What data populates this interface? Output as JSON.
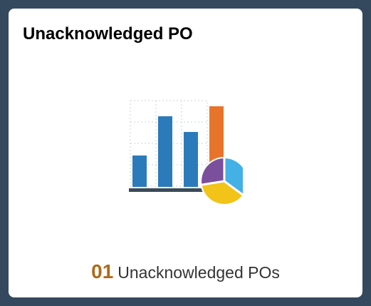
{
  "tile": {
    "title": "Unacknowledged PO",
    "image_icon": "bar-and-pie-chart-icon",
    "count": "01",
    "count_label": "Unacknowledged POs"
  },
  "colors": {
    "background": "#34485e",
    "tile_background": "#ffffff",
    "count": "#b06a1a",
    "bar_blue": "#2b7bbb",
    "bar_orange": "#e8742b",
    "pie_light_blue": "#43b0e6",
    "pie_yellow": "#f2c318",
    "pie_purple": "#7a4f9b"
  }
}
